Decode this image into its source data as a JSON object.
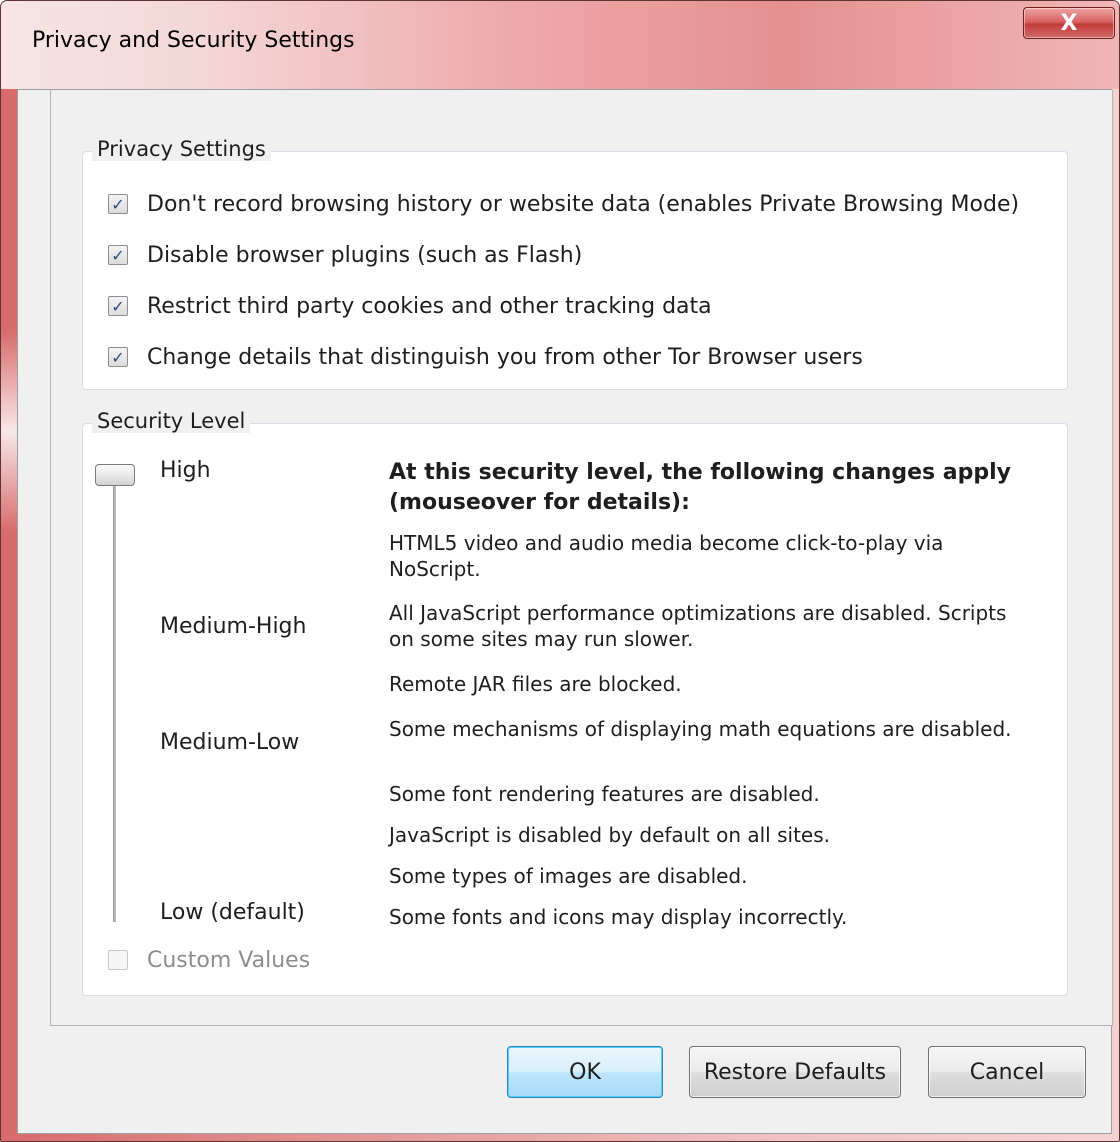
{
  "window": {
    "title": "Privacy and Security Settings",
    "close_glyph": "X"
  },
  "privacy": {
    "legend": "Privacy Settings",
    "options": [
      {
        "label": "Don't record browsing history or website data (enables Private Browsing Mode)",
        "checked": true
      },
      {
        "label": "Disable browser plugins (such as Flash)",
        "checked": true
      },
      {
        "label": "Restrict third party cookies and other tracking data",
        "checked": true
      },
      {
        "label": "Change details that distinguish you from other Tor Browser users",
        "checked": true
      }
    ]
  },
  "security": {
    "legend": "Security Level",
    "selected_level": "High",
    "levels": [
      "High",
      "Medium-High",
      "Medium-Low",
      "Low (default)"
    ],
    "description_title": "At this security level, the following changes apply (mouseover for details):",
    "changes": [
      "HTML5 video and audio media become click-to-play via NoScript.",
      "All JavaScript performance optimizations are disabled. Scripts on some sites may run slower.",
      "Remote JAR files are blocked.",
      "Some mechanisms of displaying math equations are disabled.",
      "Some font rendering features are disabled.",
      "JavaScript is disabled by default on all sites.",
      "Some types of images are disabled.",
      "Some fonts and icons may display incorrectly."
    ],
    "custom_values": {
      "label": "Custom Values",
      "checked": false,
      "enabled": false
    }
  },
  "buttons": {
    "ok": "OK",
    "restore": "Restore Defaults",
    "cancel": "Cancel"
  },
  "colors": {
    "titlebar_accent": "#e69090",
    "close_button": "#c33b3b",
    "dialog_background": "#f0f0f0",
    "checkbox_mark": "#2b4b80",
    "default_button_border": "#3c7fb1"
  }
}
